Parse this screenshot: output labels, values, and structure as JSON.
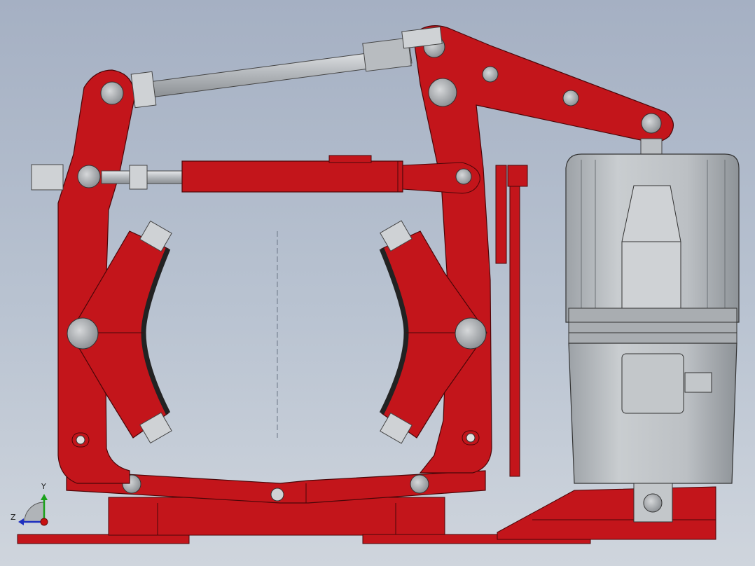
{
  "viewport": {
    "background_top": "#a5b0c3",
    "background_bottom": "#cfd5dd"
  },
  "model": {
    "description_icon": "drum-brake-assembly",
    "body_color": "#c3151b",
    "body_dark_color": "#8e0d12",
    "steel_color": "#c8cbcf",
    "thruster_color": "#b9bdc1"
  },
  "triad": {
    "y_label": "Y",
    "z_label": "Z",
    "y_color": "#1aa11a",
    "z_color": "#1d2fbf",
    "x_color": "#c81010"
  }
}
